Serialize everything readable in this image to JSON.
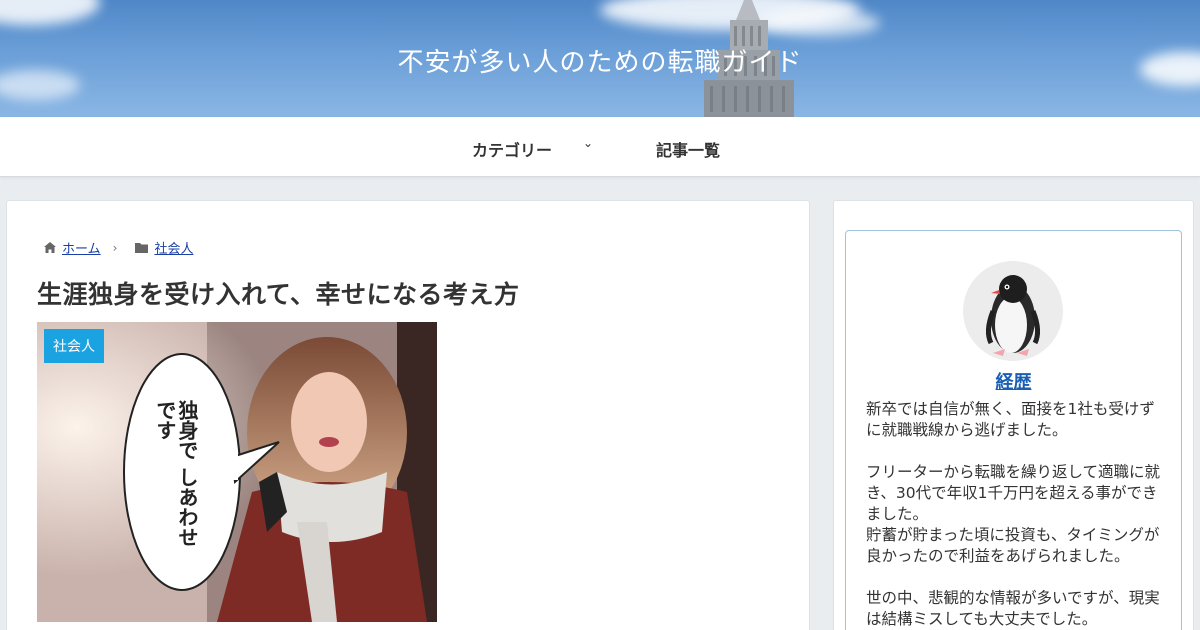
{
  "site": {
    "title": "不安が多い人のための転職ガイド"
  },
  "nav": {
    "items": [
      {
        "label": "カテゴリー",
        "has_dropdown": true
      },
      {
        "label": "記事一覧",
        "has_dropdown": false
      }
    ]
  },
  "breadcrumb": {
    "home": "ホーム",
    "category": "社会人"
  },
  "article": {
    "title": "生涯独身を受け入れて、幸せになる考え方",
    "category_label": "社会人",
    "thumbnail_bubble_text": "独身で しあわせです"
  },
  "sidebar": {
    "profile": {
      "name": "経歴",
      "paragraphs": [
        "新卒では自信が無く、面接を1社も受けずに就職戦線から逃げました。",
        "フリーターから転職を繰り返して適職に就き、30代で年収1千万円を超える事ができました。\n貯蓄が貯まった頃に投資も、タイミングが良かったので利益をあげられました。",
        "世の中、悲観的な情報が多いですが、現実は結構ミスしても大丈夫でした。"
      ]
    }
  },
  "colors": {
    "accent": "#1aa3e0",
    "link": "#1a3fa6",
    "header_sky": "#5b92d0",
    "profile_border": "#9fc4dc"
  }
}
